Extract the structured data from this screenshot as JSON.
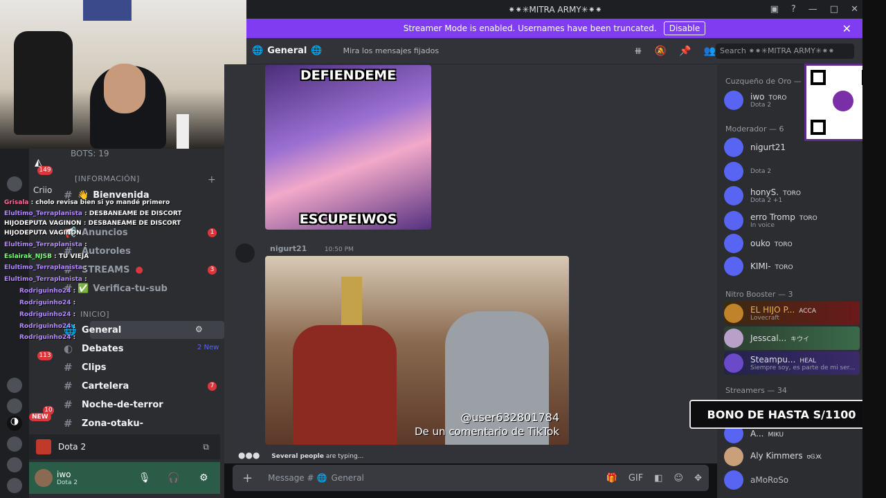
{
  "window": {
    "title": "⁕⁕✳MITRA ARMY✳⁕⁕"
  },
  "banner": {
    "text": "Streamer Mode is enabled. Usernames have been truncated.",
    "button": "Disable"
  },
  "channel_header": {
    "name": "General",
    "topic": "Mira los mensajes fijados",
    "search_placeholder": "Search ⁕⁕✳MITRA ARMY✳⁕⁕"
  },
  "sidebar": {
    "bots": "BOTS: 19",
    "category_info": "[INFORMACIÓN]",
    "category_inicio": "INICIO]",
    "badge_guild_top": "149",
    "badge_guild_mid": "113",
    "badge_guild_low": "10",
    "new_label": "NEW",
    "channels": [
      {
        "name": "Bienvenida",
        "icon": "👋"
      },
      {
        "name": "Anuncios",
        "badge": "1"
      },
      {
        "name": "Autoroles"
      },
      {
        "name": "STREAMS",
        "badge": "3"
      },
      {
        "name": "Verifica-tu-sub"
      },
      {
        "name": "General"
      },
      {
        "name": "Debates",
        "new": "2 New"
      },
      {
        "name": "Clips"
      },
      {
        "name": "Cartelera",
        "badge": "7"
      },
      {
        "name": "Noche-de-terror"
      },
      {
        "name": "Zona-otaku-"
      }
    ],
    "voice_activity": "Dota 2",
    "user": {
      "name": "iwo",
      "status": "Dota 2"
    }
  },
  "stream_chat": [
    {
      "user": "Grisala",
      "text": "cholo revisa bien si yo mandé primero",
      "color": "#ff6a9a"
    },
    {
      "user": "Elultimo_Terraplanista",
      "text": "DESBANEAME DE DISCORT",
      "color": "#b48cff"
    },
    {
      "user": "HIJODEPUTA VAGINON",
      "text": "DESBANEAME DE DISCORT",
      "color": "#ffffff"
    },
    {
      "user": "HIJODEPUTA VAGINON",
      "text": "",
      "color": "#ffffff"
    },
    {
      "user": "Elultimo_Terraplanista",
      "text": "",
      "color": "#b48cff"
    },
    {
      "user": "Eslairak_NJSB",
      "text": "TU VIEJA",
      "color": "#7cff7c"
    },
    {
      "user": "Elultimo_Terraplanista",
      "text": "",
      "color": "#b48cff"
    },
    {
      "user": "Elultimo_Terraplanista",
      "text": "",
      "color": "#b48cff"
    },
    {
      "user": "Rodriguinho24",
      "text": "",
      "color": "#b48cff"
    },
    {
      "user": "Rodriguinho24",
      "text": "",
      "color": "#b48cff"
    },
    {
      "user": "Rodriguinho24",
      "text": "",
      "color": "#b48cff"
    },
    {
      "user": "Rodriguinho24",
      "text": "",
      "color": "#b48cff"
    },
    {
      "user": "Rodriguinho24",
      "text": "",
      "color": "#b48cff"
    }
  ],
  "chat": {
    "meme1_top": "DEFIENDEME",
    "meme1_bottom": "ESCUPEIWOS",
    "author": "nigurt21",
    "time": "10:50 PM",
    "watermark_user": "@user632801784",
    "watermark_tiktok": "De un comentario de TikTok",
    "typing_user": "Several people",
    "typing_suffix": "are typing...",
    "composer_placeholder": "Message #",
    "composer_channel": "General"
  },
  "members": {
    "groups": [
      {
        "label": "Cuzqueño de Oro — 6"
      },
      {
        "label": "Moderador — 6"
      },
      {
        "label": "Nitro Booster — 3"
      },
      {
        "label": "Streamers — 34"
      }
    ],
    "list": [
      {
        "name": "iwo",
        "tag": "TORO",
        "sub": "Dota 2",
        "color": "#f2f3f5"
      },
      {
        "name": "nigurt21",
        "tag": "",
        "sub": "",
        "color": "#b5bac1"
      },
      {
        "name": "",
        "tag": "",
        "sub": "Dota 2",
        "color": "#b5bac1"
      },
      {
        "name": "honyS.",
        "tag": "TORO",
        "sub": "Dota 2 +1",
        "color": "#b5bac1"
      },
      {
        "name": "erro Tromp",
        "tag": "TORO",
        "sub": "In voice",
        "color": "#b5bac1"
      },
      {
        "name": "ouko",
        "tag": "TORO",
        "sub": "",
        "color": "#b5bac1"
      },
      {
        "name": "KIMI-",
        "tag": "TORO",
        "sub": "",
        "color": "#b5bac1"
      },
      {
        "name": "EL HIJO P...",
        "tag": "ACCA",
        "sub": "Lovecraft",
        "color": "#e8b54a"
      },
      {
        "name": "Jesscal...",
        "tag": "キウイ",
        "sub": "",
        "color": "#e8e8e8"
      },
      {
        "name": "Steampu...",
        "tag": "HEAL",
        "sub": "Siempre soy, es parte de mi ser...",
        "color": "#f2f3f5"
      },
      {
        "name": "A...",
        "tag": "MIKU",
        "sub": "",
        "color": "#b5bac1"
      },
      {
        "name": "Aly Kimmers",
        "tag": "ʊᎶ🝪",
        "sub": "",
        "color": "#dbdee1"
      },
      {
        "name": "aMoRoSo",
        "tag": "",
        "sub": "",
        "color": "#b5bac1"
      }
    ]
  },
  "overlay": {
    "bono": "BONO DE HASTA S/1100",
    "new_badge": "2 New",
    "stream_label": "Criio"
  }
}
